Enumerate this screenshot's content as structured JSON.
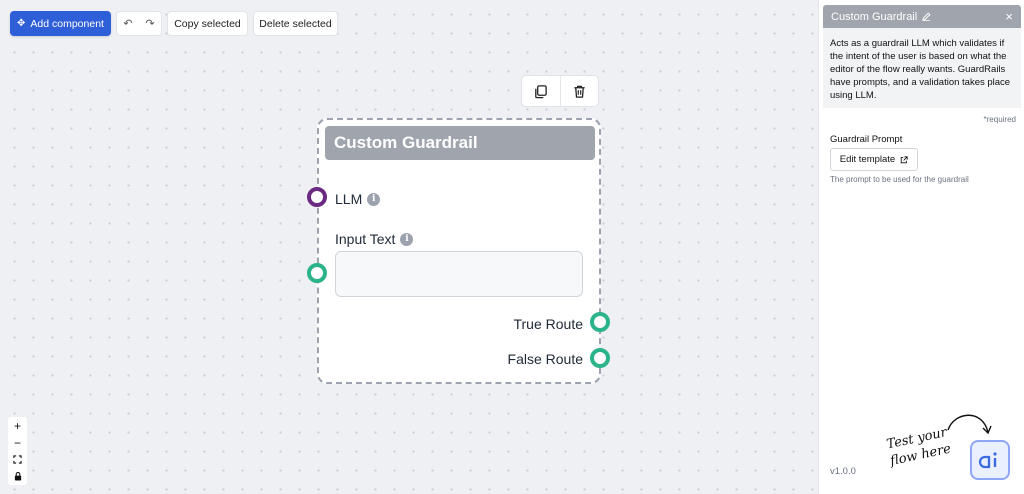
{
  "toolbar": {
    "add_component_label": "Add component",
    "copy_selected_label": "Copy selected",
    "delete_selected_label": "Delete selected"
  },
  "node": {
    "title": "Custom Guardrail",
    "llm_label": "LLM",
    "input_text_label": "Input Text",
    "true_route_label": "True Route",
    "false_route_label": "False Route"
  },
  "zoom": {
    "zoom_in": "+",
    "zoom_out": "−"
  },
  "panel": {
    "title": "Custom Guardrail",
    "close": "×",
    "description": "Acts as a guardrail LLM which validates if the intent of the user is based on what the editor of the flow really wants. GuardRails have prompts, and a validation takes place using LLM.",
    "required_note": "*required",
    "prompt_label": "Guardrail Prompt",
    "edit_template_label": "Edit template",
    "prompt_hint": "The prompt to be used for the guardrail",
    "version": "v1.0.0"
  },
  "test_flow": {
    "line1": "Test your",
    "line2": "flow here"
  },
  "colors": {
    "primary": "#2f5fd8",
    "header_gray": "#a0a4ac",
    "handle_purple": "#6b2a82",
    "handle_green": "#2bb38a"
  }
}
